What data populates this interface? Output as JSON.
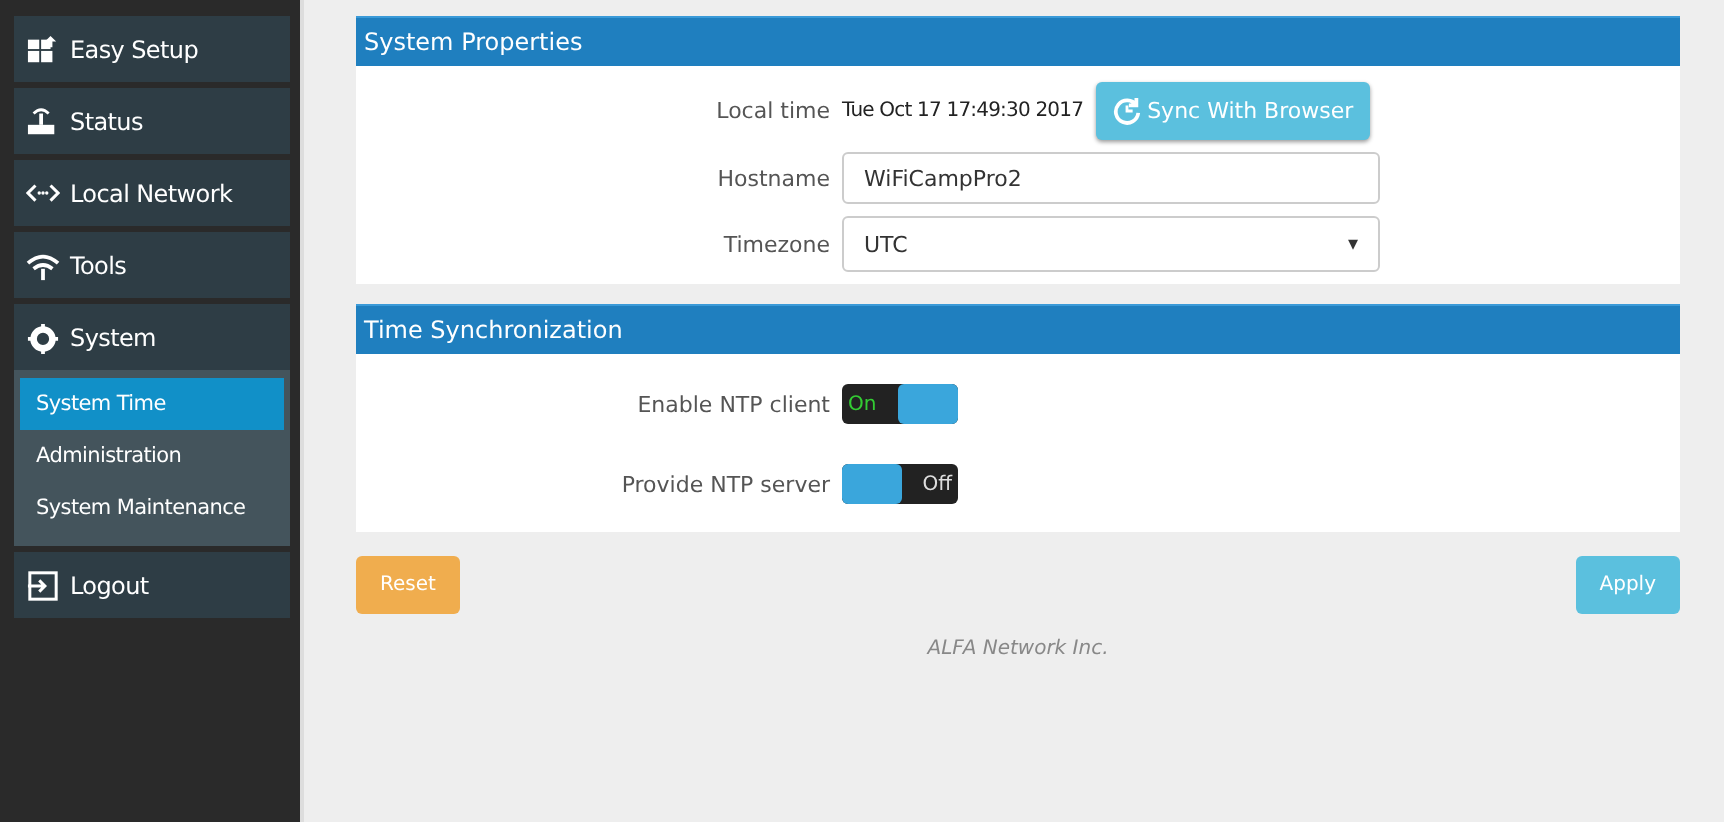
{
  "sidebar": {
    "items": [
      {
        "label": "Easy Setup"
      },
      {
        "label": "Status"
      },
      {
        "label": "Local Network"
      },
      {
        "label": "Tools"
      },
      {
        "label": "System",
        "expanded": true,
        "children": [
          {
            "label": "System Time",
            "selected": true
          },
          {
            "label": "Administration",
            "selected": false
          },
          {
            "label": "System Maintenance",
            "selected": false
          }
        ]
      },
      {
        "label": "Logout"
      }
    ]
  },
  "panels": [
    {
      "title": "System Properties",
      "rows": [
        {
          "kind": "text",
          "label": "Local time",
          "value": "Tue Oct 17 17:49:30 2017",
          "button": "Sync With Browser"
        },
        {
          "kind": "input",
          "label": "Hostname",
          "value": "WiFiCampPro2"
        },
        {
          "kind": "select",
          "label": "Timezone",
          "value": "UTC",
          "arrow": "▾"
        }
      ]
    },
    {
      "title": "Time Synchronization",
      "rows": [
        {
          "kind": "toggle",
          "label": "Enable NTP client",
          "on": true,
          "state_text": "On"
        },
        {
          "kind": "toggle",
          "label": "Provide NTP server",
          "on": false,
          "state_text": "Off"
        }
      ]
    }
  ],
  "buttons": [
    {
      "kind": "reset",
      "label": "Reset"
    },
    {
      "kind": "apply",
      "label": "Apply"
    }
  ],
  "footer": "ALFA Network Inc."
}
